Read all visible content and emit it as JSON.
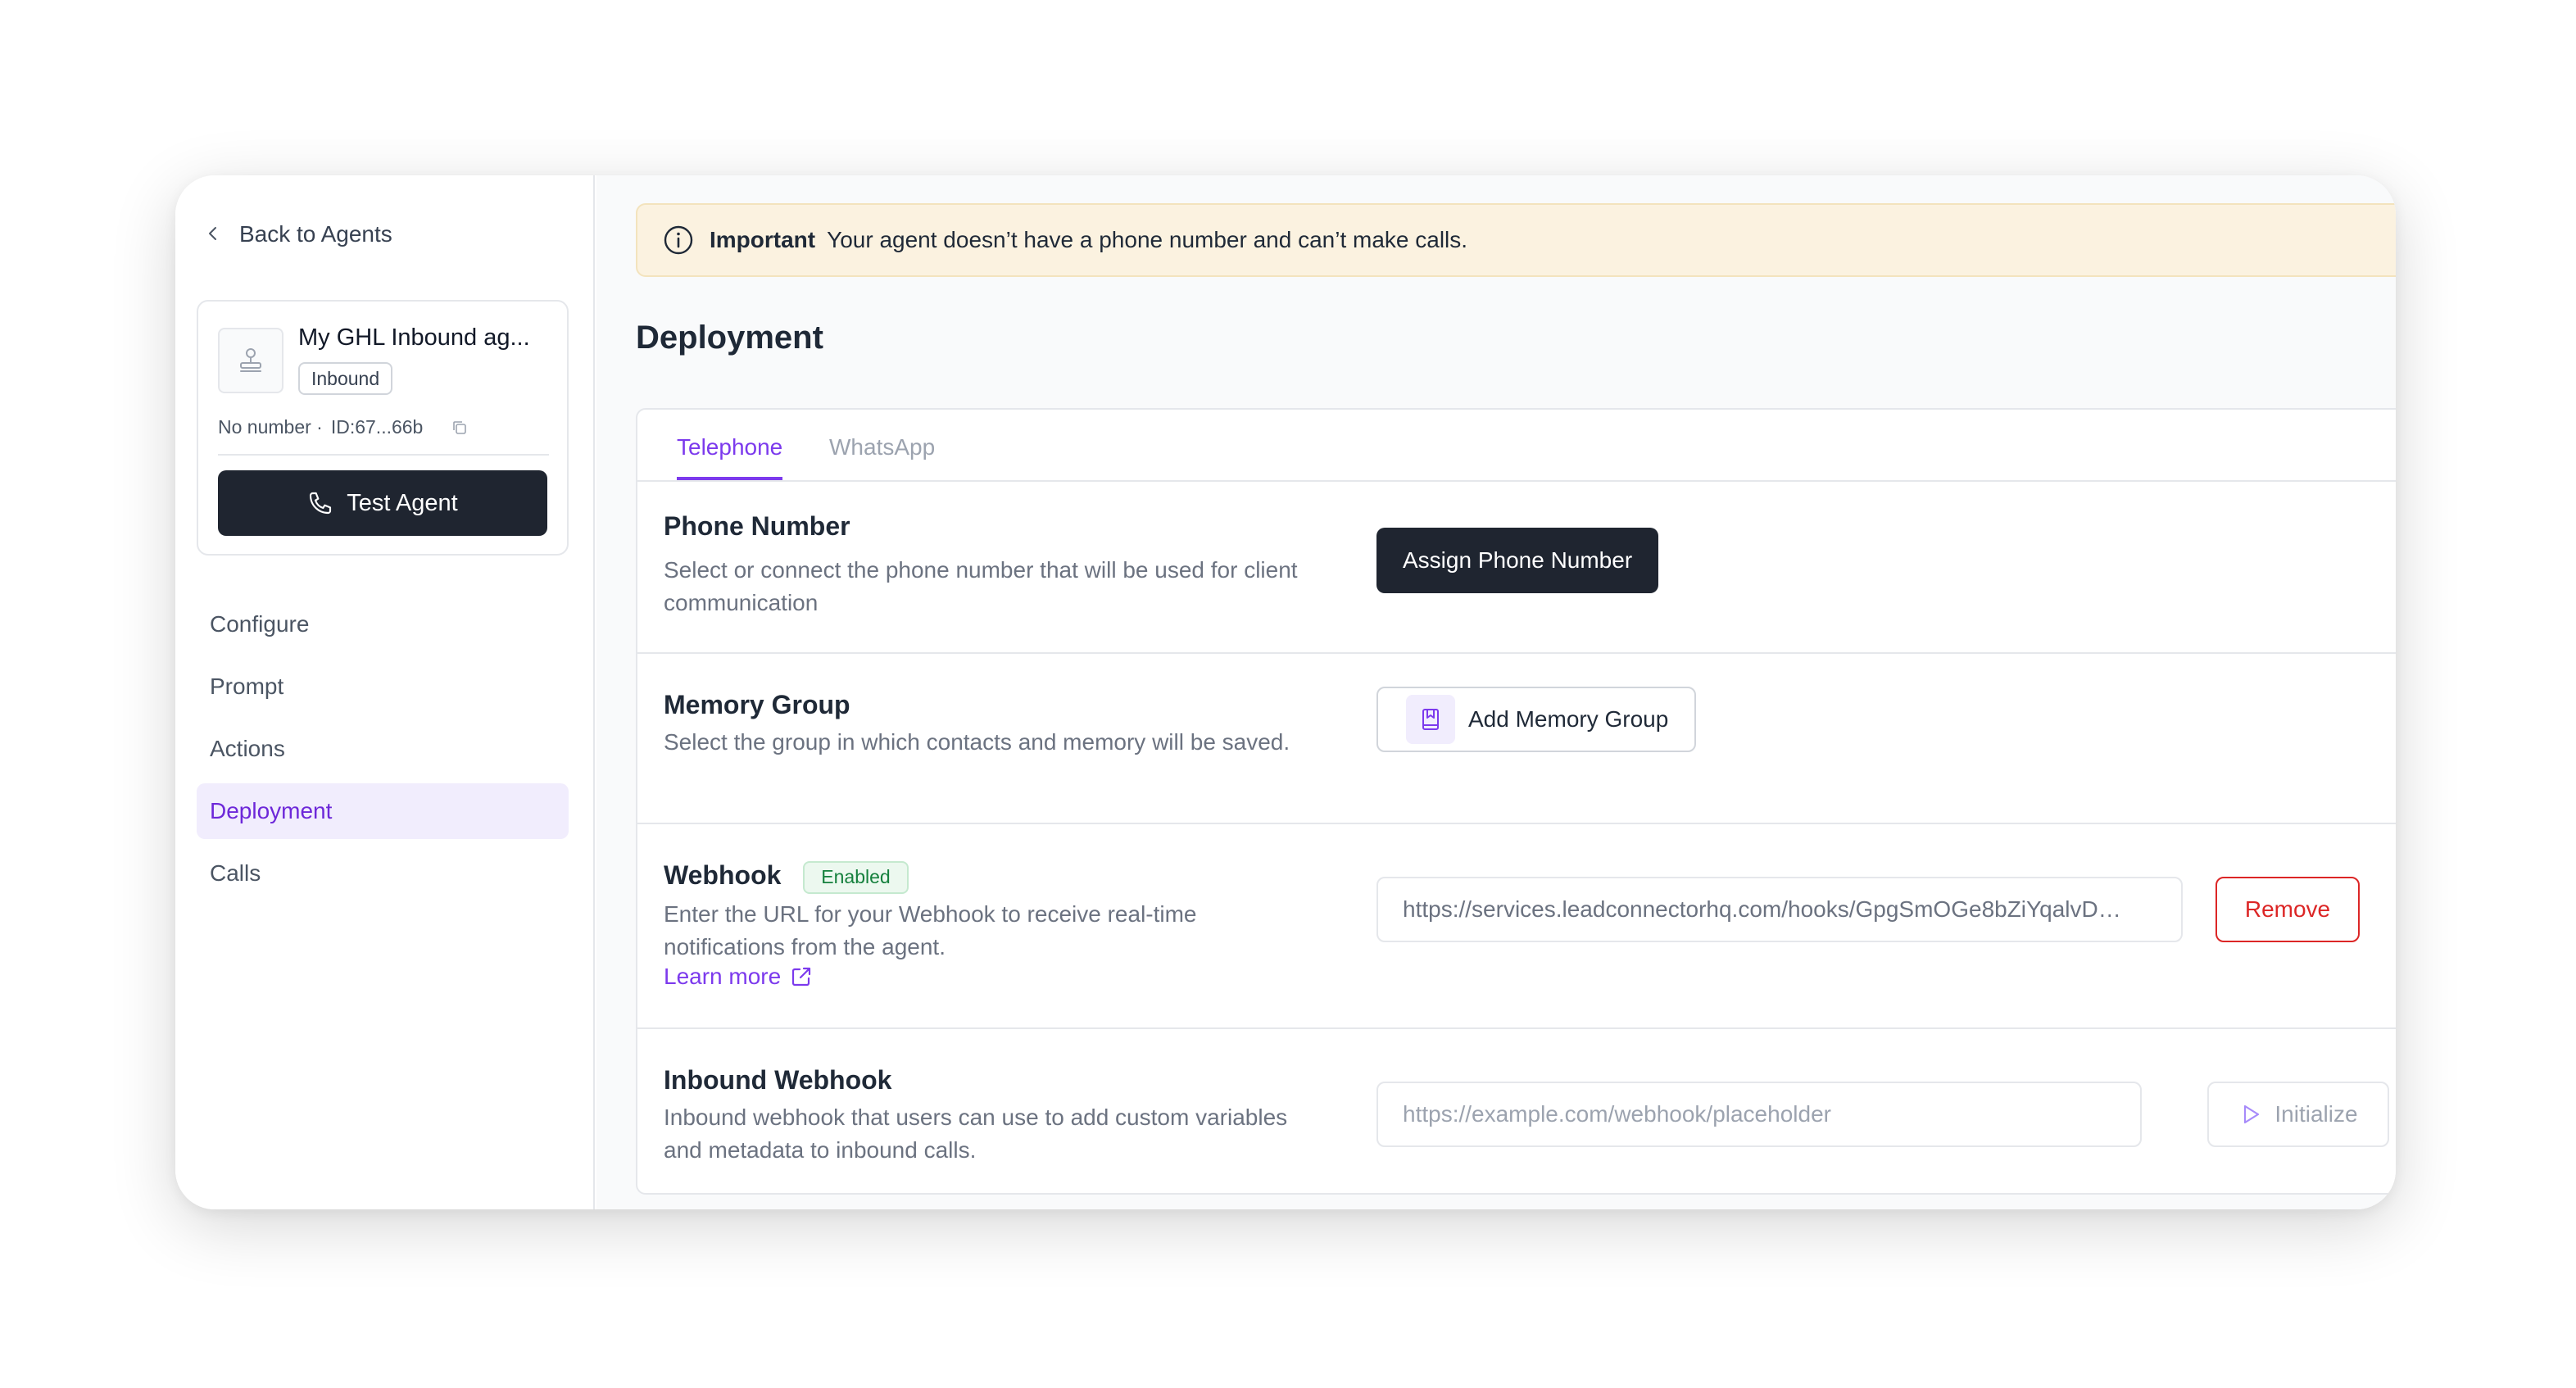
{
  "colors": {
    "accent": "#7c3aed",
    "dark_button": "#1f2530",
    "alert_bg": "#fbf2e0",
    "danger": "#dc2626",
    "success": "#15803d"
  },
  "sidebar": {
    "back_label": "Back to Agents",
    "agent": {
      "name": "My GHL Inbound ag...",
      "type_badge": "Inbound",
      "number": "No number ·",
      "id": "ID:67...66b",
      "test_button": "Test Agent"
    },
    "nav": [
      {
        "label": "Configure",
        "active": false
      },
      {
        "label": "Prompt",
        "active": false
      },
      {
        "label": "Actions",
        "active": false
      },
      {
        "label": "Deployment",
        "active": true
      },
      {
        "label": "Calls",
        "active": false
      }
    ]
  },
  "alert": {
    "icon": "info-circle-icon",
    "title": "Important",
    "message": "Your agent doesn’t have a phone number and can’t make calls."
  },
  "page": {
    "title": "Deployment"
  },
  "tabs": [
    {
      "label": "Telephone",
      "active": true
    },
    {
      "label": "WhatsApp",
      "active": false
    }
  ],
  "sections": {
    "phone": {
      "title": "Phone Number",
      "description": "Select or connect the phone number that will be used for client communication",
      "button": "Assign Phone Number"
    },
    "memory": {
      "title": "Memory Group",
      "description": "Select the group in which contacts and memory will be saved.",
      "button": "Add Memory Group"
    },
    "webhook": {
      "title": "Webhook",
      "badge": "Enabled",
      "description": "Enter the URL for your Webhook to receive real-time notifications from the agent.",
      "learn_more": "Learn more",
      "value": "https://services.leadconnectorhq.com/hooks/GpgSmOGe8bZiYqalvD…",
      "remove_button": "Remove"
    },
    "inbound": {
      "title": "Inbound Webhook",
      "description": "Inbound webhook that users can use to add custom variables and metadata to inbound calls.",
      "placeholder": "https://example.com/webhook/placeholder",
      "button": "Initialize"
    }
  }
}
